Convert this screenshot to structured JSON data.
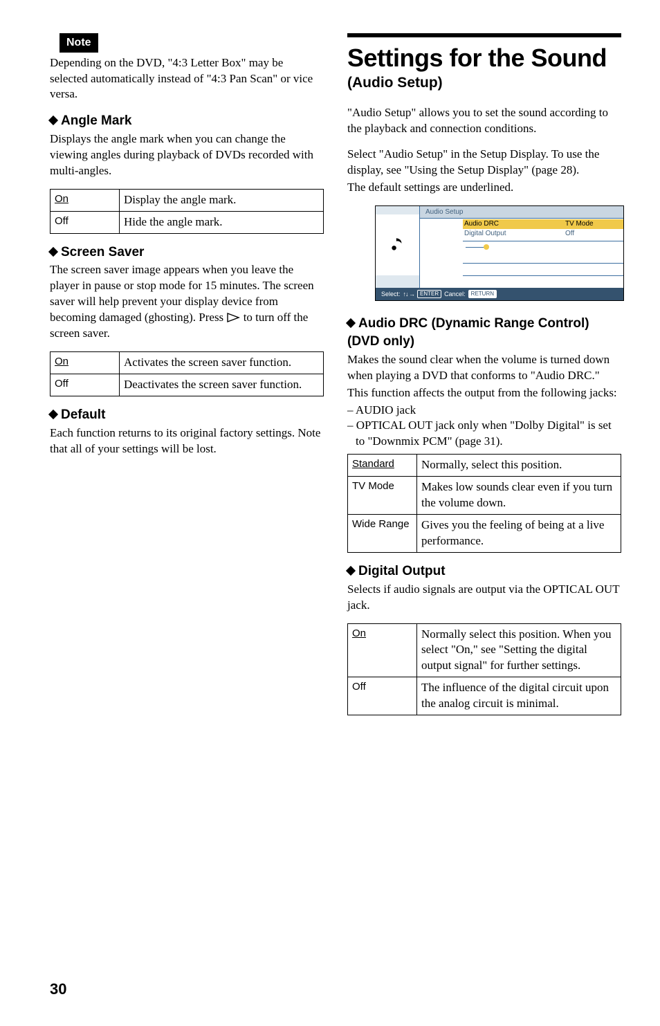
{
  "left": {
    "note_label": "Note",
    "note_body": "Depending on the DVD, \"4:3 Letter Box\" may be selected automatically instead of \"4:3 Pan Scan\" or vice versa.",
    "angle_mark": {
      "heading": "Angle Mark",
      "body": "Displays the angle mark when you can change the viewing angles during playback of DVDs recorded with multi-angles.",
      "rows": [
        {
          "key": "On",
          "val": "Display the angle mark.",
          "underline": true
        },
        {
          "key": "Off",
          "val": "Hide the angle mark.",
          "underline": false
        }
      ]
    },
    "screen_saver": {
      "heading": "Screen Saver",
      "body_pre": "The screen saver image appears when you leave the player in pause or stop mode for 15 minutes. The screen saver will help prevent your display device from becoming damaged (ghosting). Press ",
      "body_post": " to turn off the screen saver.",
      "rows": [
        {
          "key": "On",
          "val": "Activates the screen saver function.",
          "underline": true
        },
        {
          "key": "Off",
          "val": "Deactivates the screen saver function.",
          "underline": false
        }
      ]
    },
    "default": {
      "heading": "Default",
      "body": "Each function returns to its original factory settings. Note that all of your settings will be lost."
    }
  },
  "right": {
    "title": "Settings for the Sound",
    "subtitle": "(Audio Setup)",
    "intro": "\"Audio Setup\" allows you to set the sound according to the playback and connection conditions.",
    "select_body": "Select \"Audio Setup\" in the Setup Display. To use the display, see \"Using the Setup Display\" (page 28).",
    "default_note": "The default settings are underlined.",
    "panel": {
      "tab": "Audio Setup",
      "row1": {
        "label": "Audio DRC",
        "value": "TV Mode"
      },
      "row2": {
        "label": "Digital Output",
        "value": "Off"
      },
      "footer_select": "Select:",
      "footer_enter": "ENTER",
      "footer_cancel_label": "Cancel:",
      "footer_return": "RETURN"
    },
    "audio_drc": {
      "heading": "Audio DRC (Dynamic Range Control) (DVD only)",
      "body": "Makes the sound clear when the volume is turned down when playing a DVD that conforms to \"Audio DRC.\"",
      "affects": "This function affects the output from the following jacks:",
      "jacks": [
        "AUDIO jack",
        "OPTICAL OUT jack only when \"Dolby Digital\" is set to \"Downmix PCM\" (page 31)."
      ],
      "rows": [
        {
          "key": "Standard",
          "val": "Normally, select this position.",
          "underline": true
        },
        {
          "key": "TV Mode",
          "val": "Makes low sounds clear even if you turn the volume down.",
          "underline": false
        },
        {
          "key": "Wide Range",
          "val": "Gives you the feeling of being at a live performance.",
          "underline": false
        }
      ]
    },
    "digital_output": {
      "heading": "Digital Output",
      "body": "Selects if audio signals are output via the OPTICAL OUT jack.",
      "rows": [
        {
          "key": "On",
          "val": "Normally select this position. When you select \"On,\" see \"Setting the digital output signal\" for further settings.",
          "underline": true
        },
        {
          "key": "Off",
          "val": "The influence of the digital circuit upon the analog circuit is minimal.",
          "underline": false
        }
      ]
    }
  },
  "page_number": "30"
}
